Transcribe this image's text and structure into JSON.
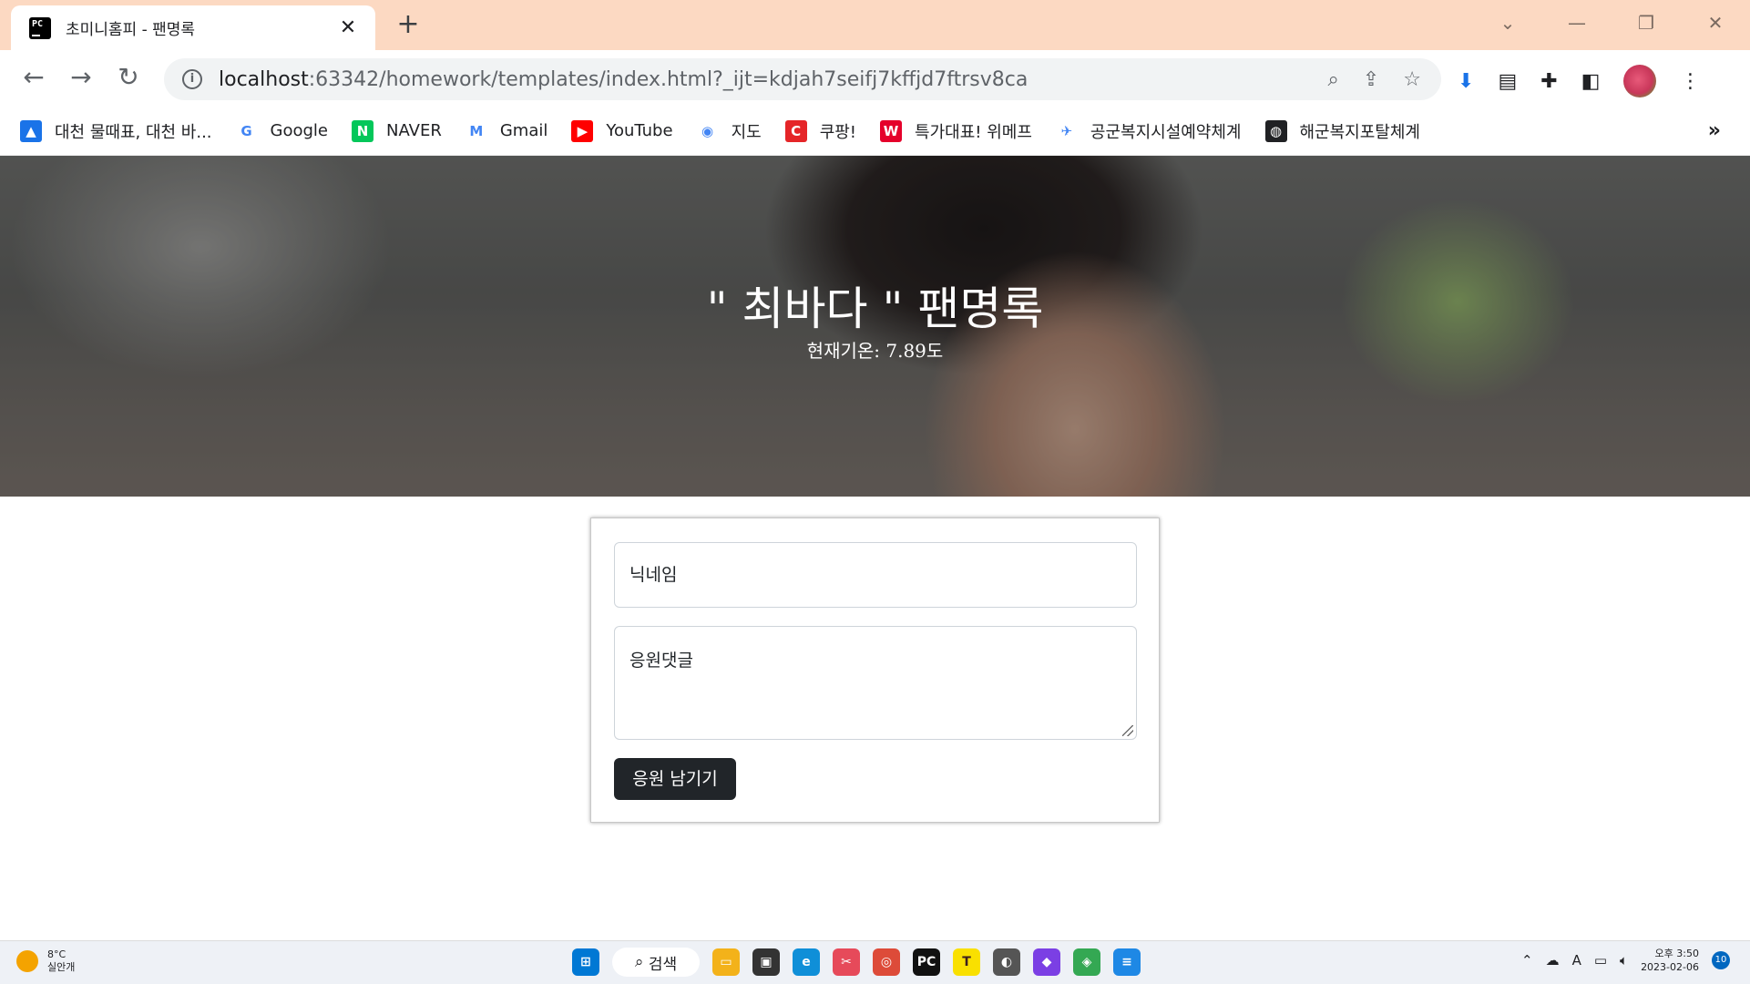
{
  "browser": {
    "tab_title": "초미니홈피 - 팬명록",
    "tab_favicon": "PC",
    "new_tab": "+",
    "window_controls": [
      "⌄",
      "—",
      "❐",
      "✕"
    ],
    "url_host": "localhost",
    "url_rest": ":63342/homework/templates/index.html?_ijt=kdjah7seifj7kffjd7ftrsv8ca",
    "bookmarks": [
      {
        "label": "대천 물때표, 대천 바...",
        "icon": "image-icon",
        "color": "#1a73e8",
        "glyph": "▲"
      },
      {
        "label": "Google",
        "icon": "google-icon",
        "color": "#ffffff",
        "glyph": "G"
      },
      {
        "label": "NAVER",
        "icon": "naver-icon",
        "color": "#03c75a",
        "glyph": "N"
      },
      {
        "label": "Gmail",
        "icon": "gmail-icon",
        "color": "#ffffff",
        "glyph": "M"
      },
      {
        "label": "YouTube",
        "icon": "youtube-icon",
        "color": "#ff0000",
        "glyph": "▶"
      },
      {
        "label": "지도",
        "icon": "maps-icon",
        "color": "#ffffff",
        "glyph": "◉"
      },
      {
        "label": "쿠팡!",
        "icon": "coupang-icon",
        "color": "#e52528",
        "glyph": "C"
      },
      {
        "label": "특가대표! 위메프",
        "icon": "wemakeprice-icon",
        "color": "#e5002b",
        "glyph": "W"
      },
      {
        "label": "공군복지시설예약체계",
        "icon": "airforce-icon",
        "color": "#ffffff",
        "glyph": "✈"
      },
      {
        "label": "해군복지포탈체계",
        "icon": "globe-icon",
        "color": "#202124",
        "glyph": "◍"
      }
    ],
    "bookmarks_more": "»"
  },
  "hero": {
    "title": "\" 최바다 \" 팬명록",
    "subtitle": "현재기온: 7.89도"
  },
  "form": {
    "nickname_placeholder": "닉네임",
    "comment_placeholder": "응원댓글",
    "submit_label": "응원 남기기"
  },
  "taskbar": {
    "weather_temp": "8°C",
    "weather_desc": "실안개",
    "search_label": "검색",
    "apps": [
      {
        "name": "file-explorer",
        "color": "#f3b21a",
        "glyph": "▭"
      },
      {
        "name": "task-view",
        "color": "#333333",
        "glyph": "▣"
      },
      {
        "name": "edge",
        "color": "#0f8fd8",
        "glyph": "e"
      },
      {
        "name": "snipping",
        "color": "#e64a5a",
        "glyph": "✂"
      },
      {
        "name": "chrome",
        "color": "#dd4b39",
        "glyph": "◎"
      },
      {
        "name": "pycharm",
        "color": "#111111",
        "glyph": "PC"
      },
      {
        "name": "kakaotalk",
        "color": "#f9e000",
        "glyph": "T"
      },
      {
        "name": "panda",
        "color": "#555555",
        "glyph": "◐"
      },
      {
        "name": "arc",
        "color": "#7b3fe4",
        "glyph": "◆"
      },
      {
        "name": "gem",
        "color": "#34a853",
        "glyph": "◈"
      },
      {
        "name": "notepad",
        "color": "#1e88e5",
        "glyph": "≡"
      }
    ],
    "time": "오후 3:50",
    "date": "2023-02-06",
    "notification_count": "10"
  }
}
